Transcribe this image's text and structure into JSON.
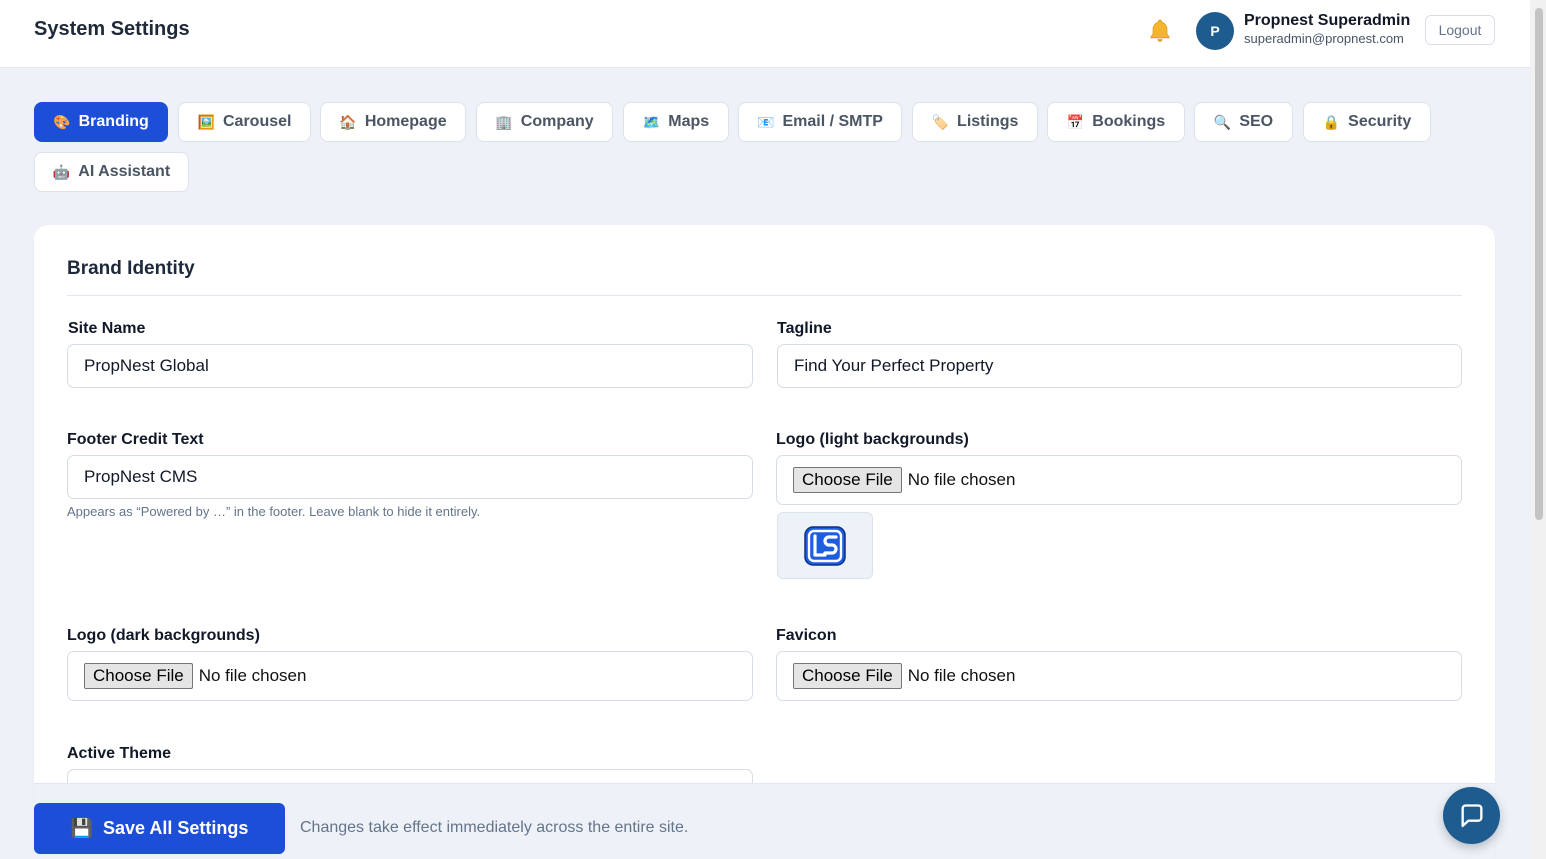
{
  "header": {
    "title": "System Settings",
    "notification_icon": "bell-icon",
    "user": {
      "avatar_initial": "P",
      "name": "Propnest Superadmin",
      "email": "superadmin@propnest.com"
    },
    "logout_label": "Logout"
  },
  "tabs": [
    {
      "icon": "🎨",
      "icon_name": "palette-icon",
      "label": "Branding",
      "active": true
    },
    {
      "icon": "🖼️",
      "icon_name": "picture-icon",
      "label": "Carousel",
      "active": false
    },
    {
      "icon": "🏠",
      "icon_name": "house-icon",
      "label": "Homepage",
      "active": false
    },
    {
      "icon": "🏢",
      "icon_name": "building-icon",
      "label": "Company",
      "active": false
    },
    {
      "icon": "🗺️",
      "icon_name": "map-icon",
      "label": "Maps",
      "active": false
    },
    {
      "icon": "📧",
      "icon_name": "email-icon",
      "label": "Email / SMTP",
      "active": false
    },
    {
      "icon": "🏷️",
      "icon_name": "tag-icon",
      "label": "Listings",
      "active": false
    },
    {
      "icon": "📅",
      "icon_name": "calendar-icon",
      "label": "Bookings",
      "active": false
    },
    {
      "icon": "🔍",
      "icon_name": "magnifier-icon",
      "label": "SEO",
      "active": false
    },
    {
      "icon": "🔒",
      "icon_name": "lock-icon",
      "label": "Security",
      "active": false
    },
    {
      "icon": "🤖",
      "icon_name": "robot-icon",
      "label": "AI Assistant",
      "active": false
    }
  ],
  "brand_identity": {
    "section_title": "Brand Identity",
    "site_name": {
      "label": "Site Name",
      "value": "PropNest Global"
    },
    "tagline": {
      "label": "Tagline",
      "value": "Find Your Perfect Property"
    },
    "footer_credit": {
      "label": "Footer Credit Text",
      "value": "PropNest CMS",
      "hint": "Appears as “Powered by …” in the footer. Leave blank to hide it entirely."
    },
    "logo_light": {
      "label": "Logo (light backgrounds)",
      "button": "Choose File",
      "status": "No file chosen",
      "preview_icon": "ls-logo-icon"
    },
    "logo_dark": {
      "label": "Logo (dark backgrounds)",
      "button": "Choose File",
      "status": "No file chosen"
    },
    "favicon": {
      "label": "Favicon",
      "button": "Choose File",
      "status": "No file chosen"
    },
    "active_theme": {
      "label": "Active Theme"
    }
  },
  "footer": {
    "save_icon": "💾",
    "save_label": "Save All Settings",
    "note": "Changes take effect immediately across the entire site.",
    "chat_icon": "chat-bubble-icon"
  },
  "colors": {
    "primary": "#1d4ed8",
    "avatar": "#1e5b8f",
    "background": "#eef2f8",
    "bell": "#f5b52e"
  }
}
